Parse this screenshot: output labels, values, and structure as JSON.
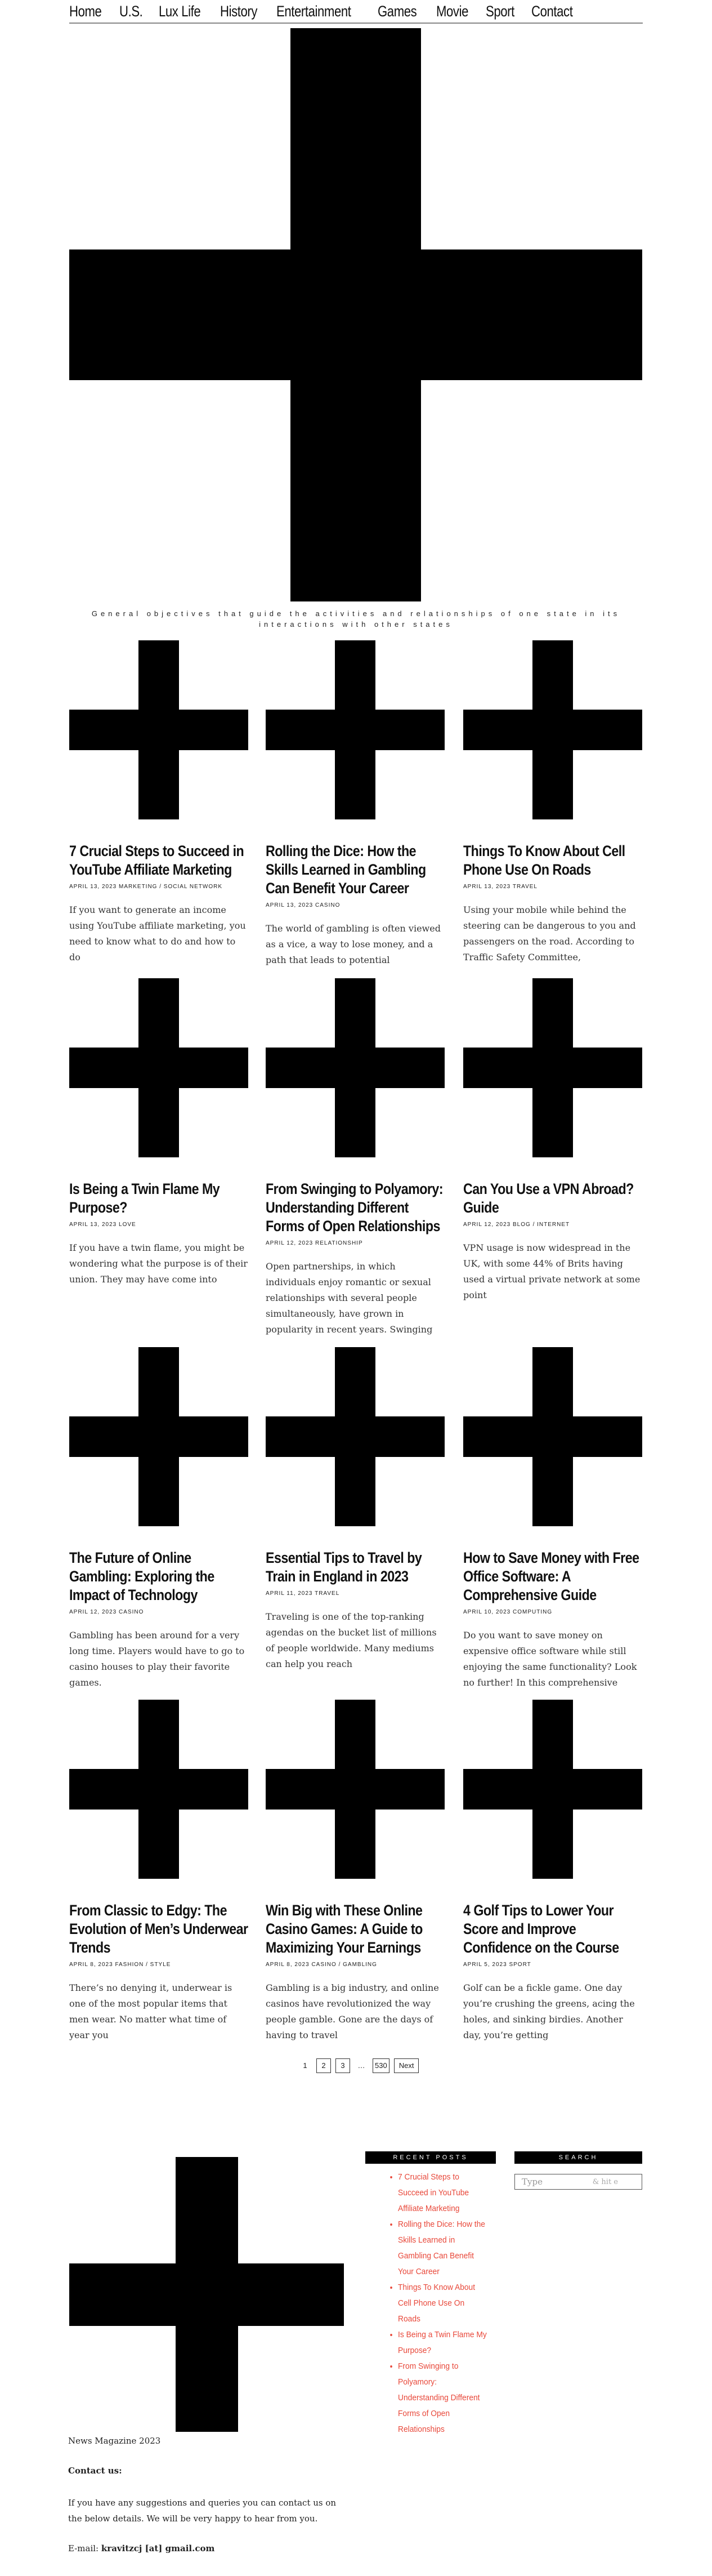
{
  "nav": {
    "items": [
      "Home",
      "U.S.",
      "Lux Life",
      "History",
      "Entertainment",
      "Games",
      "Movie",
      "Sport",
      "Contact"
    ]
  },
  "hero": {
    "image_icon": "placeholder-cross-image",
    "caption": "General objectives that guide the activities and relationships of one state in its interactions with other states"
  },
  "posts": [
    {
      "title": "7 Crucial Steps to Succeed in YouTube Affiliate Marketing",
      "meta": "APRIL 13, 2023 MARKETING / SOCIAL NETWORK",
      "excerpt": "If you want to generate an income using YouTube affiliate marketing, you need to know what to do and how to do"
    },
    {
      "title": "Rolling the Dice: How the Skills Learned in Gambling Can Benefit Your Career",
      "meta": "APRIL 13, 2023 CASINO",
      "excerpt": "The world of gambling is often viewed as a vice, a way to lose money, and a path that leads to potential"
    },
    {
      "title": "Things To Know About Cell Phone Use On Roads",
      "meta": "APRIL 13, 2023 TRAVEL",
      "excerpt": "Using your mobile while behind the steering can be dangerous to you and passengers on the road. According to Traffic Safety Committee,"
    },
    {
      "title": "Is Being a Twin Flame My Purpose?",
      "meta": "APRIL 13, 2023 LOVE",
      "excerpt": "If you have a twin flame, you might be wondering what the purpose is of their union. They may have come into"
    },
    {
      "title": "From Swinging to Polyamory: Understanding Different Forms of Open Relationships",
      "meta": "APRIL 12, 2023 RELATIONSHIP",
      "excerpt": "Open partnerships, in which individuals enjoy romantic or sexual relationships with several people simultaneously, have grown in popularity in recent years. Swinging"
    },
    {
      "title": "Can You Use a VPN Abroad? Guide",
      "meta": "APRIL 12, 2023 BLOG / INTERNET",
      "excerpt": "VPN usage is now widespread in the UK, with some 44% of Brits having used a virtual private network at some point"
    },
    {
      "title": "The Future of Online Gambling: Exploring the Impact of Technology",
      "meta": "APRIL 12, 2023 CASINO",
      "excerpt": "Gambling has been around for a very long time. Players would have to go to casino houses to play their favorite games."
    },
    {
      "title": "Essential Tips to Travel by Train in England in 2023",
      "meta": "APRIL 11, 2023 TRAVEL",
      "excerpt": "Traveling is one of the top-ranking agendas on the bucket list of millions of people worldwide. Many mediums can help you reach"
    },
    {
      "title": "How to Save Money with Free Office Software: A Comprehensive Guide",
      "meta": "APRIL 10, 2023 COMPUTING",
      "excerpt": "Do you want to save money on expensive office software while still enjoying the same functionality? Look no further! In this comprehensive"
    },
    {
      "title": "From Classic to Edgy: The Evolution of Men’s Underwear Trends",
      "meta": "APRIL 8, 2023 FASHION / STYLE",
      "excerpt": "There’s no denying it, underwear is one of the most popular items that men wear. No matter what time of year you"
    },
    {
      "title": "Win Big with These Online Casino Games: A Guide to Maximizing Your Earnings",
      "meta": "APRIL 8, 2023 CASINO / GAMBLING",
      "excerpt": "Gambling is a big industry, and online casinos have revolutionized the way people gamble. Gone are the days of having to travel"
    },
    {
      "title": "4 Golf Tips to Lower Your Score and Improve Confidence on the Course",
      "meta": "APRIL 5, 2023 SPORT",
      "excerpt": "Golf can be a fickle game. One day you’re crushing the greens, acing the holes, and sinking birdies. Another day, you’re getting"
    }
  ],
  "pagination": {
    "current": "1",
    "pages": [
      "2",
      "3"
    ],
    "ellipsis": "…",
    "last": "530",
    "next": "Next"
  },
  "sidebar": {
    "recent_title": "RECENT POSTS",
    "recent_items": [
      "7 Crucial Steps to Succeed in YouTube Affiliate Marketing",
      "Rolling the Dice: How the Skills Learned in Gambling Can Benefit Your Career",
      "Things To Know About Cell Phone Use On Roads",
      "Is Being a Twin Flame My Purpose?",
      "From Swinging to Polyamory: Understanding Different Forms of Open Relationships"
    ],
    "search_title": "SEARCH",
    "search_placeholder": "Type",
    "search_button": "& hit e"
  },
  "footer": {
    "site_name": "News Magazine 2023",
    "contact_heading": "Contact us:",
    "contact_text": "If you have any suggestions and queries you can contact us on the below details. We will be very happy to hear from you.",
    "email_label": "E-mail:",
    "email_value": "kravitzcj [at] gmail.com"
  }
}
